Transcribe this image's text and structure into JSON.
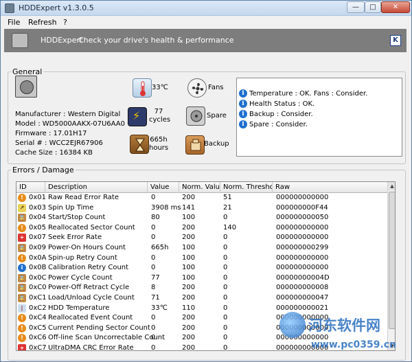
{
  "window": {
    "title": "HDDExpert v1.3.0.5",
    "btn_min": "—",
    "btn_max": "□",
    "btn_close": "✕"
  },
  "menu": {
    "items": [
      "File",
      "Refresh",
      "?"
    ]
  },
  "banner": {
    "name": "HDDExpert",
    "slogan": "Check your drive's health & performance",
    "badge": "K"
  },
  "general": {
    "legend": "General",
    "info": {
      "manufacturer": "Manufacturer : Western Digital",
      "model": "Model : WD5000AAKX-07U6AA0",
      "firmware": "Firmware : 17.01H17",
      "serial": "Serial # : WCC2EJR67906",
      "cache": "Cache Size : 16384 KB"
    },
    "stats": {
      "temperature": "33℃",
      "cycles_value": "77",
      "cycles_unit": "cycles",
      "hours_value": "665h",
      "hours_unit": "hours",
      "fans": "Fans",
      "spare": "Spare",
      "backup": "Backup"
    },
    "status_lines": [
      "Temperature : OK. Fans : Consider.",
      "Health Status : OK.",
      "Backup : Consider.",
      "Spare : Consider."
    ]
  },
  "errors": {
    "legend": "Errors / Damage",
    "columns": [
      "ID",
      "Description",
      "Value",
      "Norm. Value",
      "Norm. Threshold",
      "Raw"
    ],
    "rows": [
      {
        "icon": "warning-icon",
        "id": "0x01",
        "desc": "Raw Read Error Rate",
        "value": "0",
        "norm": "200",
        "thr": "51",
        "raw": "000000000000"
      },
      {
        "icon": "spin-icon",
        "id": "0x03",
        "desc": "Spin Up Time",
        "value": "3908 ms",
        "norm": "141",
        "thr": "21",
        "raw": "000000000F44"
      },
      {
        "icon": "hourglass-icon",
        "id": "0x04",
        "desc": "Start/Stop Count",
        "value": "80",
        "norm": "100",
        "thr": "0",
        "raw": "000000000050"
      },
      {
        "icon": "warning-icon",
        "id": "0x05",
        "desc": "Reallocated Sector Count",
        "value": "0",
        "norm": "200",
        "thr": "140",
        "raw": "000000000000"
      },
      {
        "icon": "seek-icon",
        "id": "0x07",
        "desc": "Seek Error Rate",
        "value": "0",
        "norm": "200",
        "thr": "0",
        "raw": "000000000000"
      },
      {
        "icon": "hourglass-icon",
        "id": "0x09",
        "desc": "Power-On Hours Count",
        "value": "665h",
        "norm": "100",
        "thr": "0",
        "raw": "000000000299"
      },
      {
        "icon": "warning-icon",
        "id": "0x0A",
        "desc": "Spin-up Retry Count",
        "value": "0",
        "norm": "100",
        "thr": "0",
        "raw": "000000000000"
      },
      {
        "icon": "info-icon",
        "id": "0x0B",
        "desc": "Calibration Retry Count",
        "value": "0",
        "norm": "100",
        "thr": "0",
        "raw": "000000000000"
      },
      {
        "icon": "hourglass-icon",
        "id": "0x0C",
        "desc": "Power Cycle Count",
        "value": "77",
        "norm": "100",
        "thr": "0",
        "raw": "00000000004D"
      },
      {
        "icon": "hourglass-icon",
        "id": "0xC0",
        "desc": "Power-Off Retract Cycle",
        "value": "8",
        "norm": "200",
        "thr": "0",
        "raw": "000000000008"
      },
      {
        "icon": "hourglass-icon",
        "id": "0xC1",
        "desc": "Load/Unload Cycle Count",
        "value": "71",
        "norm": "200",
        "thr": "0",
        "raw": "000000000047"
      },
      {
        "icon": "thermometer-icon",
        "id": "0xC2",
        "desc": "HDD Temperature",
        "value": "33℃",
        "norm": "110",
        "thr": "0",
        "raw": "000000000021"
      },
      {
        "icon": "warning-icon",
        "id": "0xC4",
        "desc": "Reallocated Event Count",
        "value": "0",
        "norm": "200",
        "thr": "0",
        "raw": "000000000000"
      },
      {
        "icon": "warning-icon",
        "id": "0xC5",
        "desc": "Current Pending Sector Count",
        "value": "0",
        "norm": "200",
        "thr": "0",
        "raw": "000000000000"
      },
      {
        "icon": "warning-icon",
        "id": "0xC6",
        "desc": "Off-line Scan Uncorrectable Count",
        "value": "0",
        "norm": "200",
        "thr": "0",
        "raw": "000000000000"
      },
      {
        "icon": "seek-icon",
        "id": "0xC7",
        "desc": "UltraDMA CRC Error Rate",
        "value": "0",
        "norm": "200",
        "thr": "0",
        "raw": "000000000000"
      }
    ]
  },
  "watermark": {
    "cn": "河东软件网",
    "url": "www.pc0359.cn"
  }
}
